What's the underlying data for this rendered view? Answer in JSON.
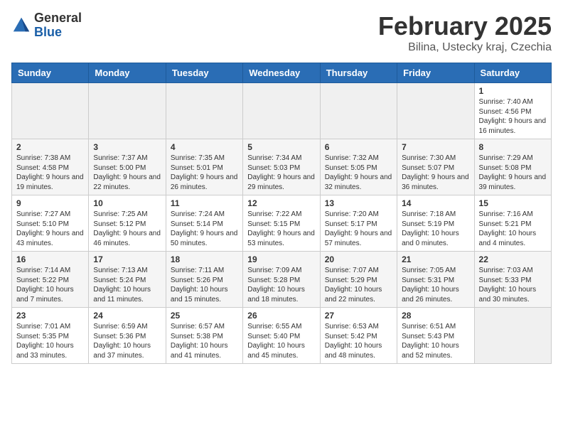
{
  "header": {
    "logo_general": "General",
    "logo_blue": "Blue",
    "month_year": "February 2025",
    "location": "Bilina, Ustecky kraj, Czechia"
  },
  "calendar": {
    "days_of_week": [
      "Sunday",
      "Monday",
      "Tuesday",
      "Wednesday",
      "Thursday",
      "Friday",
      "Saturday"
    ],
    "weeks": [
      [
        {
          "day": "",
          "info": ""
        },
        {
          "day": "",
          "info": ""
        },
        {
          "day": "",
          "info": ""
        },
        {
          "day": "",
          "info": ""
        },
        {
          "day": "",
          "info": ""
        },
        {
          "day": "",
          "info": ""
        },
        {
          "day": "1",
          "info": "Sunrise: 7:40 AM\nSunset: 4:56 PM\nDaylight: 9 hours and 16 minutes."
        }
      ],
      [
        {
          "day": "2",
          "info": "Sunrise: 7:38 AM\nSunset: 4:58 PM\nDaylight: 9 hours and 19 minutes."
        },
        {
          "day": "3",
          "info": "Sunrise: 7:37 AM\nSunset: 5:00 PM\nDaylight: 9 hours and 22 minutes."
        },
        {
          "day": "4",
          "info": "Sunrise: 7:35 AM\nSunset: 5:01 PM\nDaylight: 9 hours and 26 minutes."
        },
        {
          "day": "5",
          "info": "Sunrise: 7:34 AM\nSunset: 5:03 PM\nDaylight: 9 hours and 29 minutes."
        },
        {
          "day": "6",
          "info": "Sunrise: 7:32 AM\nSunset: 5:05 PM\nDaylight: 9 hours and 32 minutes."
        },
        {
          "day": "7",
          "info": "Sunrise: 7:30 AM\nSunset: 5:07 PM\nDaylight: 9 hours and 36 minutes."
        },
        {
          "day": "8",
          "info": "Sunrise: 7:29 AM\nSunset: 5:08 PM\nDaylight: 9 hours and 39 minutes."
        }
      ],
      [
        {
          "day": "9",
          "info": "Sunrise: 7:27 AM\nSunset: 5:10 PM\nDaylight: 9 hours and 43 minutes."
        },
        {
          "day": "10",
          "info": "Sunrise: 7:25 AM\nSunset: 5:12 PM\nDaylight: 9 hours and 46 minutes."
        },
        {
          "day": "11",
          "info": "Sunrise: 7:24 AM\nSunset: 5:14 PM\nDaylight: 9 hours and 50 minutes."
        },
        {
          "day": "12",
          "info": "Sunrise: 7:22 AM\nSunset: 5:15 PM\nDaylight: 9 hours and 53 minutes."
        },
        {
          "day": "13",
          "info": "Sunrise: 7:20 AM\nSunset: 5:17 PM\nDaylight: 9 hours and 57 minutes."
        },
        {
          "day": "14",
          "info": "Sunrise: 7:18 AM\nSunset: 5:19 PM\nDaylight: 10 hours and 0 minutes."
        },
        {
          "day": "15",
          "info": "Sunrise: 7:16 AM\nSunset: 5:21 PM\nDaylight: 10 hours and 4 minutes."
        }
      ],
      [
        {
          "day": "16",
          "info": "Sunrise: 7:14 AM\nSunset: 5:22 PM\nDaylight: 10 hours and 7 minutes."
        },
        {
          "day": "17",
          "info": "Sunrise: 7:13 AM\nSunset: 5:24 PM\nDaylight: 10 hours and 11 minutes."
        },
        {
          "day": "18",
          "info": "Sunrise: 7:11 AM\nSunset: 5:26 PM\nDaylight: 10 hours and 15 minutes."
        },
        {
          "day": "19",
          "info": "Sunrise: 7:09 AM\nSunset: 5:28 PM\nDaylight: 10 hours and 18 minutes."
        },
        {
          "day": "20",
          "info": "Sunrise: 7:07 AM\nSunset: 5:29 PM\nDaylight: 10 hours and 22 minutes."
        },
        {
          "day": "21",
          "info": "Sunrise: 7:05 AM\nSunset: 5:31 PM\nDaylight: 10 hours and 26 minutes."
        },
        {
          "day": "22",
          "info": "Sunrise: 7:03 AM\nSunset: 5:33 PM\nDaylight: 10 hours and 30 minutes."
        }
      ],
      [
        {
          "day": "23",
          "info": "Sunrise: 7:01 AM\nSunset: 5:35 PM\nDaylight: 10 hours and 33 minutes."
        },
        {
          "day": "24",
          "info": "Sunrise: 6:59 AM\nSunset: 5:36 PM\nDaylight: 10 hours and 37 minutes."
        },
        {
          "day": "25",
          "info": "Sunrise: 6:57 AM\nSunset: 5:38 PM\nDaylight: 10 hours and 41 minutes."
        },
        {
          "day": "26",
          "info": "Sunrise: 6:55 AM\nSunset: 5:40 PM\nDaylight: 10 hours and 45 minutes."
        },
        {
          "day": "27",
          "info": "Sunrise: 6:53 AM\nSunset: 5:42 PM\nDaylight: 10 hours and 48 minutes."
        },
        {
          "day": "28",
          "info": "Sunrise: 6:51 AM\nSunset: 5:43 PM\nDaylight: 10 hours and 52 minutes."
        },
        {
          "day": "",
          "info": ""
        }
      ]
    ]
  }
}
